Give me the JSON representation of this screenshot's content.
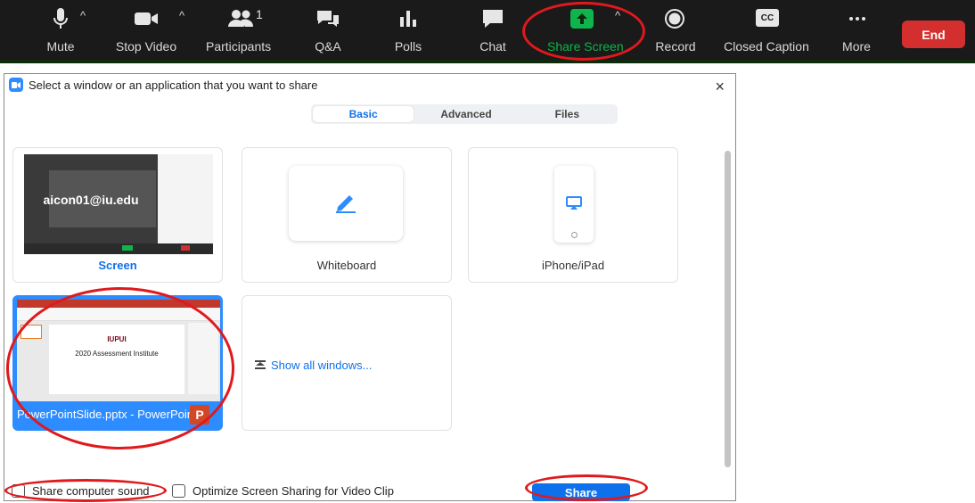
{
  "toolbar": {
    "mute": "Mute",
    "stop_video": "Stop Video",
    "participants": "Participants",
    "participant_count": "1",
    "qa": "Q&A",
    "polls": "Polls",
    "chat": "Chat",
    "share_screen": "Share Screen",
    "record": "Record",
    "closed_caption": "Closed Caption",
    "cc_badge": "CC",
    "more": "More",
    "end": "End",
    "colors": {
      "bg": "#1a1a1a",
      "share_green": "#0fb44c",
      "end_red": "#d32f2f"
    }
  },
  "dialog": {
    "title": "Select a window or an application that you want to share",
    "tabs": [
      {
        "label": "Basic",
        "active": true
      },
      {
        "label": "Advanced",
        "active": false
      },
      {
        "label": "Files",
        "active": false
      }
    ],
    "tiles": {
      "screen": {
        "label": "Screen",
        "preview_text": "aicon01@iu.edu"
      },
      "whiteboard": {
        "label": "Whiteboard"
      },
      "iphone": {
        "label": "iPhone/iPad"
      },
      "powerpoint": {
        "label": "PowerPointSlide.pptx - PowerPoint",
        "slide_brand": "IUPUI",
        "slide_title": "2020 Assessment Institute",
        "app_badge": "P"
      },
      "show_all": {
        "label": "Show all windows..."
      }
    },
    "share_sound": "Share computer sound",
    "optimize": "Optimize Screen Sharing for Video Clip",
    "share_button": "Share",
    "close_glyph": "×"
  }
}
